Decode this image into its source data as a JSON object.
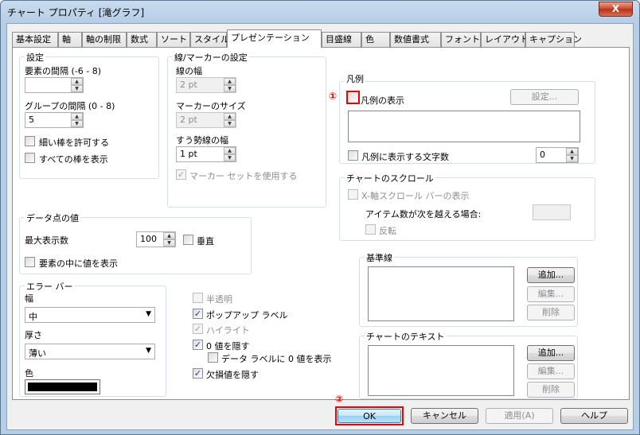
{
  "window": {
    "title": "チャート プロパティ [滝グラフ]",
    "close_label": "X"
  },
  "tabs": [
    {
      "label": "基本設定"
    },
    {
      "label": "軸"
    },
    {
      "label": "軸の制限"
    },
    {
      "label": "数式"
    },
    {
      "label": "ソート"
    },
    {
      "label": "スタイル"
    },
    {
      "label": "プレゼンテーション"
    },
    {
      "label": "目盛線"
    },
    {
      "label": "色"
    },
    {
      "label": "数値書式"
    },
    {
      "label": "フォント"
    },
    {
      "label": "レイアウト"
    },
    {
      "label": "キャプション"
    }
  ],
  "settings_group": {
    "title": "設定",
    "element_spacing_label": "要素の間隔 (-6 - 8)",
    "element_spacing_value": "",
    "group_spacing_label": "グループの間隔 (0 - 8)",
    "group_spacing_value": "5",
    "thin_bars_label": "細い棒を許可する",
    "all_bars_label": "すべての棒を表示"
  },
  "line_marker_group": {
    "title": "線/マーカーの設定",
    "line_width_label": "線の幅",
    "line_width_value": "2 pt",
    "marker_size_label": "マーカーのサイズ",
    "marker_size_value": "2 pt",
    "trend_width_label": "すう勢線の幅",
    "trend_width_value": "1 pt",
    "use_marker_set_label": "マーカー セットを使用する"
  },
  "datapoint_group": {
    "title": "データ点の値",
    "max_display_label": "最大表示数",
    "max_display_value": "100",
    "vertical_label": "垂直",
    "show_in_element_label": "要素の中に値を表示"
  },
  "error_bar_group": {
    "title": "エラー バー",
    "width_label": "幅",
    "width_value": "中",
    "thickness_label": "厚さ",
    "thickness_value": "薄い",
    "color_label": "色"
  },
  "misc_checks": {
    "semi_transparent": "半透明",
    "popup_label": "ポップアップ ラベル",
    "highlight": "ハイライト",
    "hide_zero": "0 値を隠す",
    "show_zero_label": "データ ラベルに 0 値を表示",
    "hide_missing": "欠損値を隠す"
  },
  "legend_group": {
    "title": "凡例",
    "show_legend_label": "凡例の表示",
    "settings_button": "設定...",
    "chars_label": "凡例に表示する文字数",
    "chars_value": "0"
  },
  "scroll_group": {
    "title": "チャートのスクロール",
    "x_scroll_label": "X-軸スクロール バーの表示",
    "items_exceed_label": "アイテム数が次を越える場合:",
    "reverse_label": "反転"
  },
  "reference_group": {
    "title": "基準線",
    "add": "追加...",
    "edit": "編集...",
    "delete": "削除"
  },
  "chart_text_group": {
    "title": "チャートのテキスト",
    "add": "追加...",
    "edit": "編集...",
    "delete": "削除"
  },
  "footer": {
    "ok": "OK",
    "cancel": "キャンセル",
    "apply": "適用(A)",
    "help": "ヘルプ"
  },
  "annotations": {
    "marker1": "①",
    "marker2": "②"
  },
  "colors": {
    "highlight_red": "#e00000",
    "error_bar_color": "#000000"
  }
}
